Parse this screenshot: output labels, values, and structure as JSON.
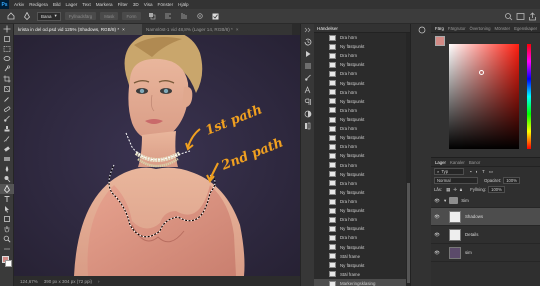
{
  "menubar": {
    "logo": "Ps",
    "items": [
      "Arkiv",
      "Redigera",
      "Bild",
      "Lager",
      "Text",
      "Markera",
      "Filter",
      "3D",
      "Visa",
      "Fönster",
      "Hjälp"
    ]
  },
  "options": {
    "mode_value": "Bana",
    "fill_button": "Fyllnadsfärg",
    "mask_button": "Mask",
    "shape_button": "Form"
  },
  "tabs": [
    {
      "label": "krista in del od.psd vid 125% (Shadows, RGB/8) *",
      "active": true
    },
    {
      "label": "Namnlöst-1 vid 48,8% (Lager 14, RGB/8) *",
      "active": false
    }
  ],
  "canvas": {
    "annotation_1": "1st path",
    "annotation_2": "2nd path"
  },
  "status": {
    "zoom": "124,67%",
    "doc_size": "390 px x 304 px (72 ppi)"
  },
  "history": {
    "title": "Händelser",
    "items": [
      "Dra hörn",
      "Ny fästpunkt",
      "Dra hörn",
      "Ny fästpunkt",
      "Dra hörn",
      "Ny fästpunkt",
      "Dra hörn",
      "Ny fästpunkt",
      "Dra hörn",
      "Ny fästpunkt",
      "Dra hörn",
      "Ny fästpunkt",
      "Dra hörn",
      "Ny fästpunkt",
      "Dra hörn",
      "Ny fästpunkt",
      "Dra hörn",
      "Ny fästpunkt",
      "Dra hörn",
      "Ny fästpunkt",
      "Dra hörn",
      "Ny fästpunkt",
      "Dra hörn",
      "Ny fästpunkt",
      "Stäl frame",
      "Ny fästpunkt",
      "Stäl frame",
      "Markeringsklasing"
    ],
    "selected_index": 27
  },
  "color_panel": {
    "tabs": [
      "Färg",
      "Färgrutor",
      "Övertoning",
      "Mönster",
      "Egenskaper"
    ],
    "fg_color": "#d38b86"
  },
  "layers_panel": {
    "tabs": [
      "Lager",
      "Kanaler",
      "Banor"
    ],
    "filter_label": "Typ",
    "blend_mode": "Normal",
    "opacity_label": "Opacitet:",
    "opacity_value": "100%",
    "lock_label": "Lås:",
    "fill_label": "Fyllning:",
    "fill_value": "100%",
    "layers": [
      {
        "name": "Sim",
        "type": "group",
        "selected": false
      },
      {
        "name": "Shadows",
        "type": "layer",
        "selected": true
      },
      {
        "name": "Details",
        "type": "layer",
        "selected": false
      },
      {
        "name": "sim",
        "type": "layer",
        "selected": false
      }
    ]
  }
}
